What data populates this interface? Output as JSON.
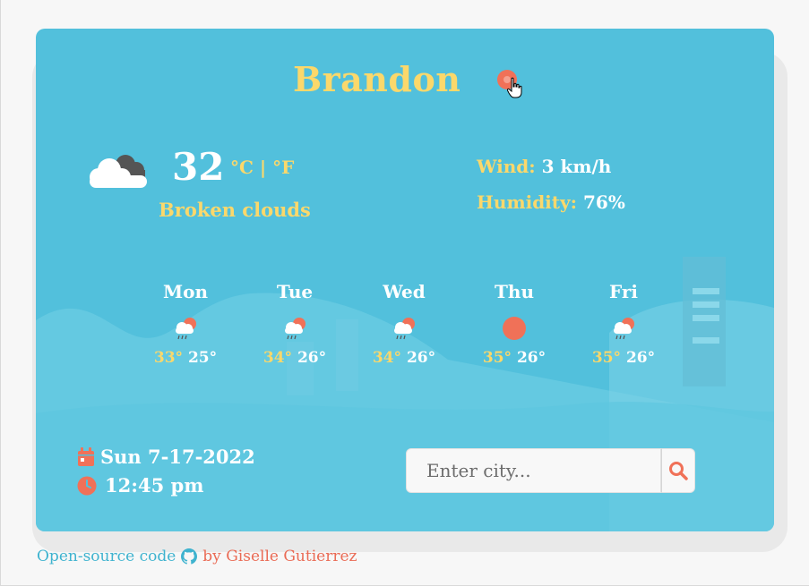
{
  "city": "Brandon",
  "current": {
    "icon": "broken-clouds-icon",
    "temperature": "32",
    "units": {
      "celsius": "°C",
      "separator": "|",
      "fahrenheit": "°F"
    },
    "description": "Broken clouds",
    "wind_label": "Wind:",
    "wind_value": "3 km/h",
    "humidity_label": "Humidity:",
    "humidity_value": "76%"
  },
  "forecast": [
    {
      "day": "Mon",
      "icon": "rain-sun-icon",
      "high": "33°",
      "low": "25°"
    },
    {
      "day": "Tue",
      "icon": "rain-sun-icon",
      "high": "34°",
      "low": "26°"
    },
    {
      "day": "Wed",
      "icon": "rain-sun-icon",
      "high": "34°",
      "low": "26°"
    },
    {
      "day": "Thu",
      "icon": "sun-icon",
      "high": "35°",
      "low": "26°"
    },
    {
      "day": "Fri",
      "icon": "rain-sun-icon",
      "high": "35°",
      "low": "26°"
    }
  ],
  "datetime": {
    "date": "Sun 7-17-2022",
    "time": "12:45 pm"
  },
  "search": {
    "placeholder": "Enter city...",
    "value": ""
  },
  "footer": {
    "code_link": "Open-source code",
    "by": "by",
    "author": "Giselle Gutierrez"
  },
  "colors": {
    "card": "#52c0dc",
    "accent": "#fbd86b",
    "coral": "#f07158",
    "text": "#ffffff"
  }
}
